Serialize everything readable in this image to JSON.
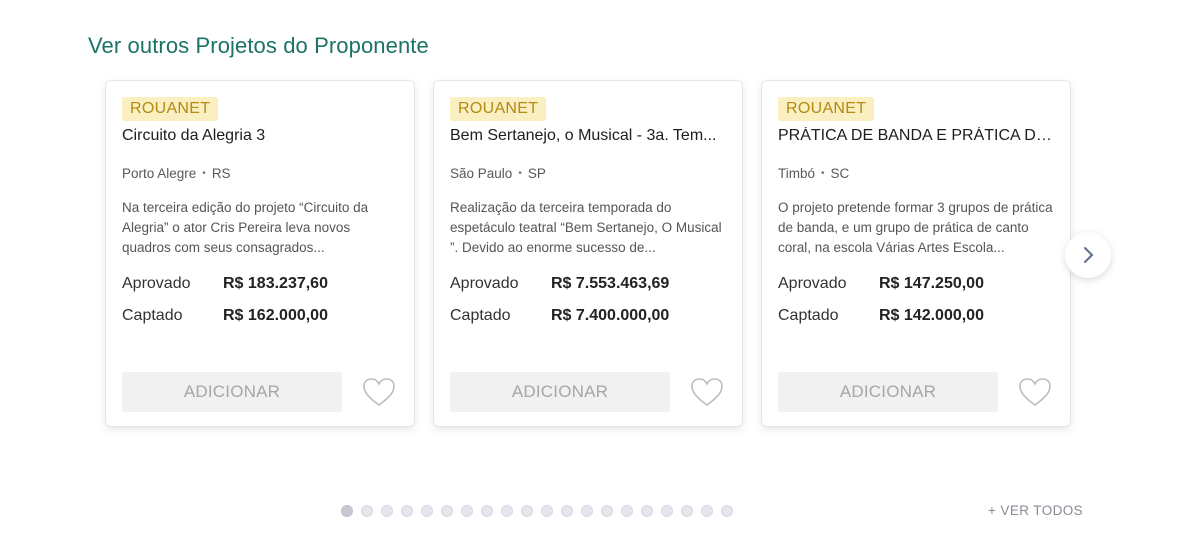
{
  "section": {
    "title": "Ver outros Projetos do Proponente"
  },
  "cards": [
    {
      "badge": "ROUANET",
      "title": "Circuito da Alegria 3",
      "city": "Porto Alegre",
      "state": "RS",
      "description": "Na terceira edição do projeto “Circuito da Alegria” o ator Cris Pereira leva novos quadros com seus consagrados...",
      "approved_label": "Aprovado",
      "approved_value": "R$ 183.237,60",
      "raised_label": "Captado",
      "raised_value": "R$ 162.000,00",
      "add_label": "ADICIONAR"
    },
    {
      "badge": "ROUANET",
      "title": "Bem Sertanejo, o Musical - 3a. Tem...",
      "city": "São Paulo",
      "state": "SP",
      "description": "Realização da terceira temporada do espetáculo teatral “Bem Sertanejo, O Musical ”. Devido ao enorme sucesso de...",
      "approved_label": "Aprovado",
      "approved_value": "R$ 7.553.463,69",
      "raised_label": "Captado",
      "raised_value": "R$ 7.400.000,00",
      "add_label": "ADICIONAR"
    },
    {
      "badge": "ROUANET",
      "title": "PRÁTICA DE BANDA E PRÁTICA DE ...",
      "city": "Timbó",
      "state": "SC",
      "description": "O projeto pretende formar 3 grupos de prática de banda, e um grupo de prática de canto coral, na escola Várias Artes Escola...",
      "approved_label": "Aprovado",
      "approved_value": "R$ 147.250,00",
      "raised_label": "Captado",
      "raised_value": "R$ 142.000,00",
      "add_label": "ADICIONAR"
    }
  ],
  "carousel": {
    "page_count": 20,
    "active_page": 1,
    "next_icon": "chevron-right-icon"
  },
  "see_all": {
    "label": "+ VER TODOS"
  },
  "colors": {
    "title": "#1b7366",
    "badge_bg": "#faefc0",
    "badge_text": "#b48a12"
  }
}
